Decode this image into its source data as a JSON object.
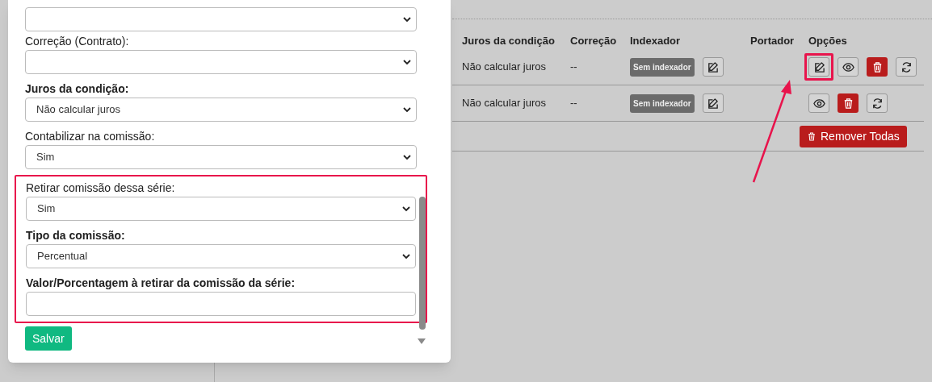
{
  "table": {
    "columns": [
      "Juros da condição",
      "Correção",
      "Indexador",
      "Portador",
      "Opções"
    ],
    "rows": [
      {
        "juros": "Não calcular juros",
        "correcao": "--",
        "indexador": "Sem indexador",
        "options": [
          {
            "kind": "edit",
            "highlighted": true
          },
          {
            "kind": "view",
            "highlighted": false
          },
          {
            "kind": "delete",
            "highlighted": false
          },
          {
            "kind": "refresh",
            "highlighted": false
          }
        ]
      },
      {
        "juros": "Não calcular juros",
        "correcao": "--",
        "indexador": "Sem indexador",
        "options": [
          {
            "kind": "view",
            "highlighted": false
          },
          {
            "kind": "delete",
            "highlighted": false
          },
          {
            "kind": "refresh",
            "highlighted": false
          }
        ]
      }
    ],
    "remove_all_button": "Remover Todas"
  },
  "modal": {
    "fields": [
      {
        "kind": "select"
      },
      {
        "kind": "select",
        "label": "Correção (Contrato):",
        "bold": false
      },
      {
        "kind": "select",
        "label": "Juros da condição:",
        "bold": true,
        "value": "Não calcular juros"
      },
      {
        "kind": "select",
        "label": "Contabilizar na comissão:",
        "bold": false,
        "value": "Sim"
      }
    ],
    "highlighted_fields": [
      {
        "kind": "select",
        "label": "Retirar comissão dessa série:",
        "bold": false,
        "value": "Sim"
      },
      {
        "kind": "select",
        "label": "Tipo da comissão:",
        "bold": true,
        "value": "Percentual"
      },
      {
        "kind": "input",
        "label": "Valor/Porcentagem à retirar da comissão da série:",
        "bold": true
      }
    ],
    "save_button": "Salvar"
  }
}
